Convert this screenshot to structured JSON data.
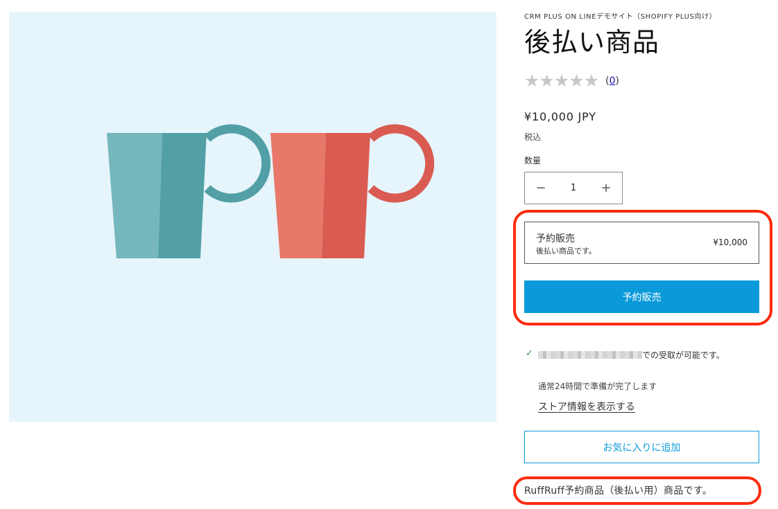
{
  "product": {
    "vendor": "CRM PLUS ON LINEデモサイト（SHOPIFY PLUS向け）",
    "title": "後払い商品",
    "rating": {
      "stars": [
        "★",
        "★",
        "★",
        "★",
        "★"
      ],
      "count_prefix": "(",
      "count": "0",
      "count_suffix": ")",
      "value": 0
    },
    "price": "¥10,000 JPY",
    "tax_note": "税込",
    "description": "RuffRuff予約商品（後払い用）商品です。"
  },
  "quantity": {
    "label": "数量",
    "minus": "−",
    "value": "1",
    "plus": "+"
  },
  "preorder": {
    "option_title": "予約販売",
    "option_desc": "後払い商品です。",
    "option_price": "¥10,000",
    "button_label": "予約販売"
  },
  "pickup": {
    "check_icon": "✓",
    "availability_suffix": "での受取が可能です。",
    "ready_time": "通常24時間で準備が完了します",
    "store_link": "ストア情報を表示する"
  },
  "favorite_button": "お気に入りに追加",
  "colors": {
    "accent": "#0a9ad9",
    "highlight": "#ff2a0d",
    "media_bg": "#e6f4fb",
    "mug_teal": "#75b7bd",
    "mug_coral": "#e87869"
  }
}
